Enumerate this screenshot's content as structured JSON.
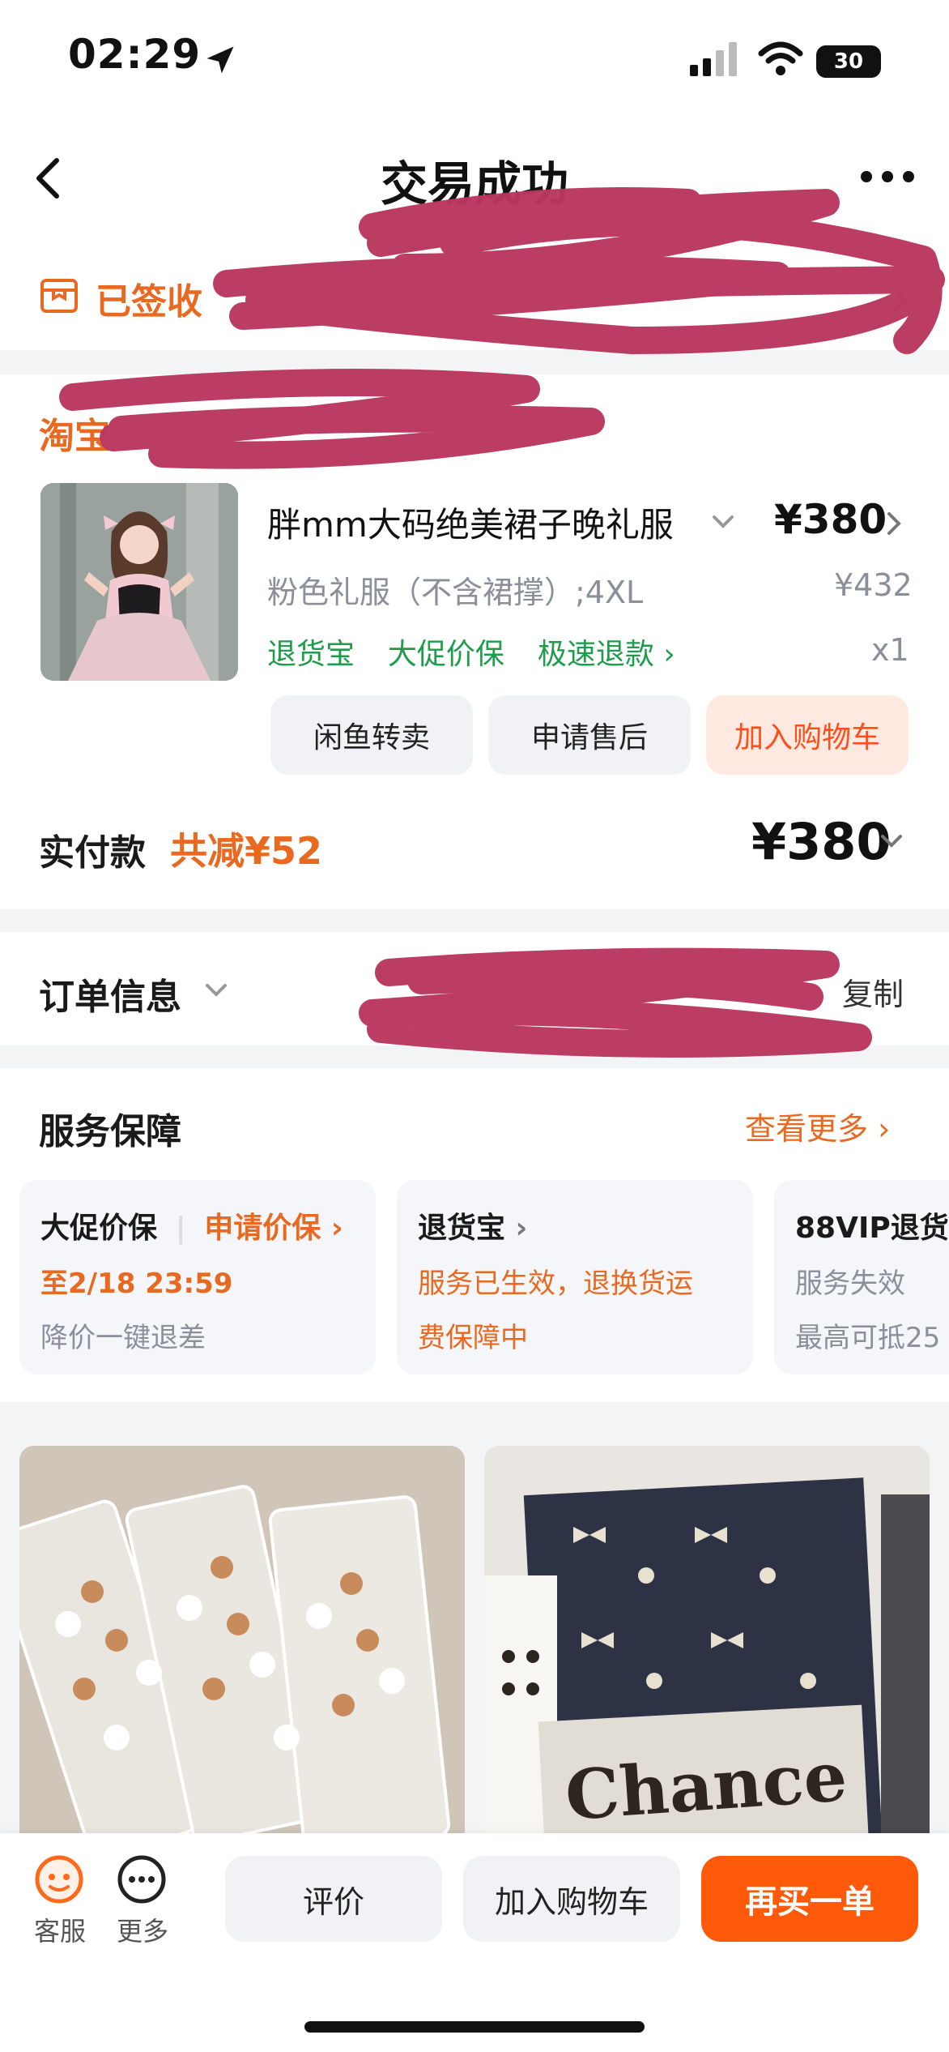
{
  "status_bar": {
    "time": "02:29",
    "battery": "30"
  },
  "nav": {
    "title": "交易成功"
  },
  "signed": {
    "label": "已签收"
  },
  "shop": {
    "name_visible": "淘宝"
  },
  "item": {
    "title": "胖mm大码绝美裙子晚礼服",
    "price": "¥380",
    "variant": "粉色礼服（不含裙撑）;4XL",
    "original_price": "¥432",
    "tags": [
      "退货宝",
      "大促价保",
      "极速退款"
    ],
    "qty": "x1",
    "actions": [
      "闲鱼转卖",
      "申请售后",
      "加入购物车"
    ]
  },
  "payment": {
    "label": "实付款",
    "discount": "共减¥52",
    "total": "¥380"
  },
  "order_info": {
    "label": "订单信息",
    "copy": "复制"
  },
  "service": {
    "title": "服务保障",
    "more": "查看更多",
    "cards": [
      {
        "head": "大促价保",
        "action": "申请价保",
        "line1": "至2/18 23:59",
        "line2": "降价一键退差"
      },
      {
        "head": "退货宝",
        "line1": "服务已生效，退换货运",
        "line2": "费保障中"
      },
      {
        "head": "88VIP退货",
        "line1": "服务失效",
        "line2": "最高可抵25"
      }
    ]
  },
  "recommend": {
    "right_text": "Chance"
  },
  "bottom": {
    "service_label": "客服",
    "more_label": "更多",
    "review": "评价",
    "add_cart": "加入购物车",
    "buy_again": "再买一单"
  },
  "colors": {
    "accent": "#ff5a0a",
    "orange_text": "#e8691f",
    "green": "#1f9c4b",
    "redact": "#b9375e"
  }
}
